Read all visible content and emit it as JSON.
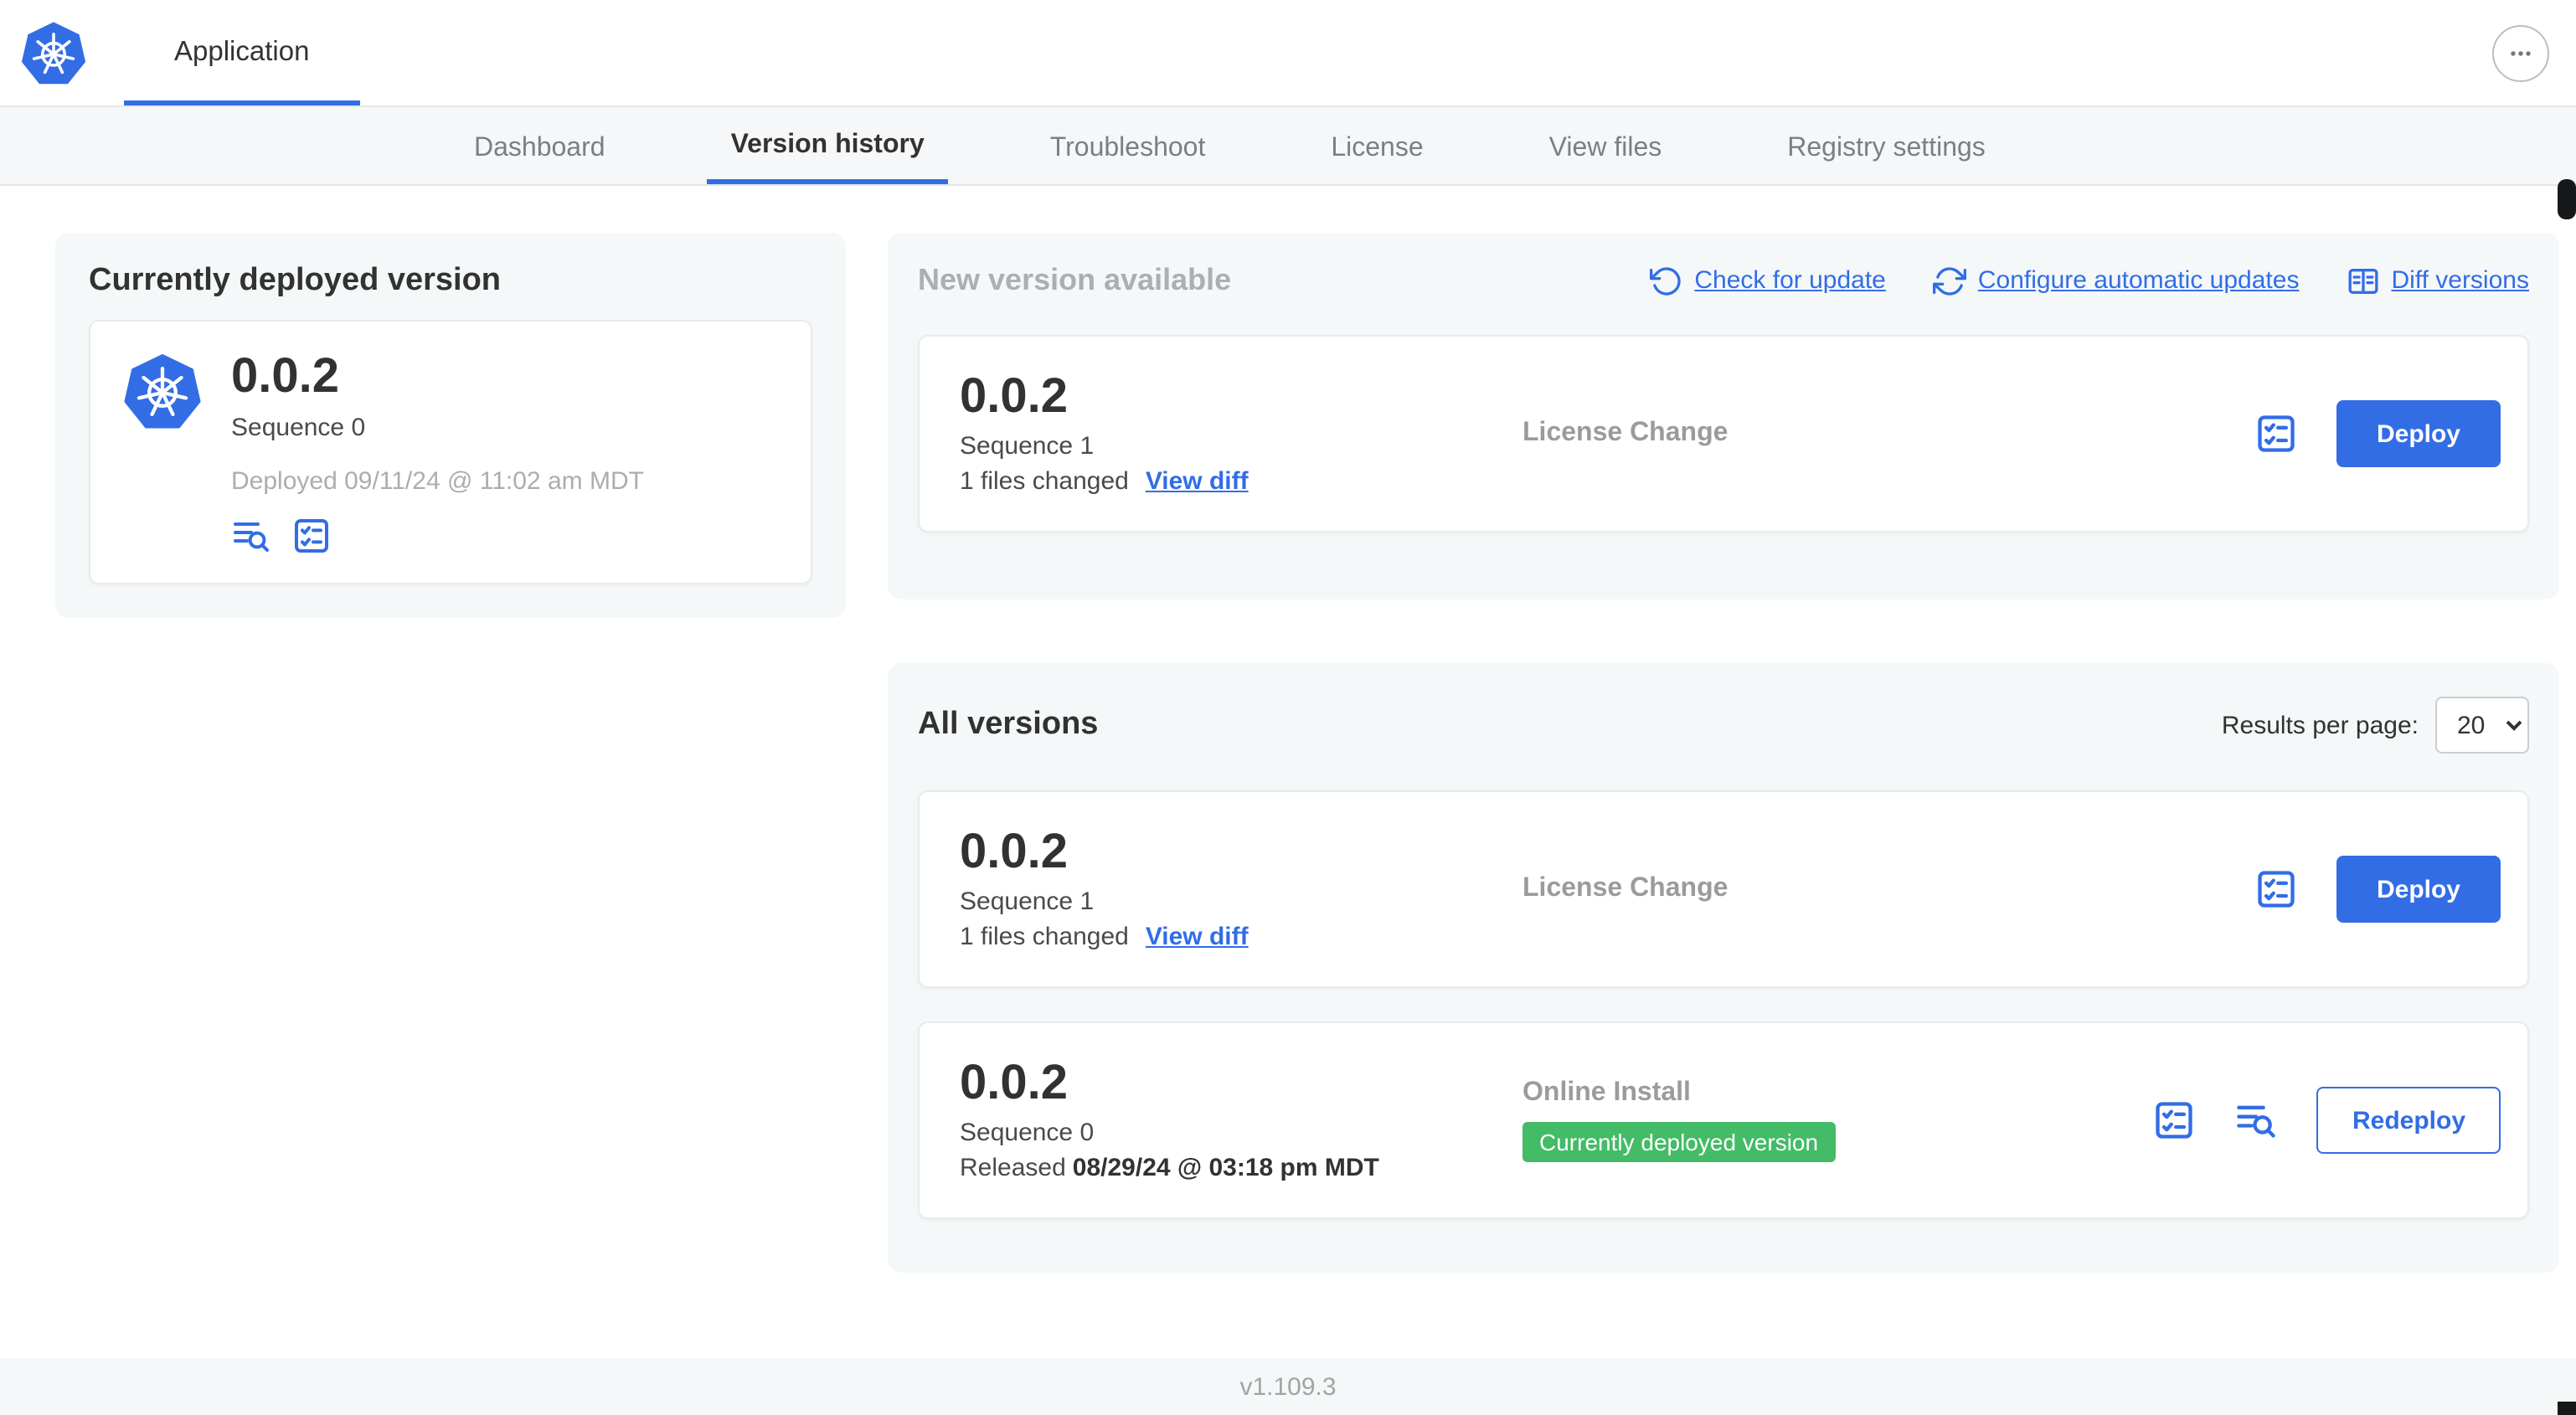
{
  "colors": {
    "accent": "#326de6",
    "badge_green": "#44bb66",
    "panel_bg": "#f5f8f9",
    "text_dark": "#323232",
    "text_gray": "#9b9b9b"
  },
  "icons": {
    "logo": "kubernetes-helm",
    "more": "ellipsis-horizontal",
    "check_for_update": "rotate-ccw-arrow",
    "configure_automatic_updates": "circular-sync-arrows",
    "diff_versions": "split-table-diff",
    "release_notes": "text-lines-magnifier",
    "view_config": "checklist-box"
  },
  "header": {
    "app_title": "Application"
  },
  "nav": {
    "tabs": [
      {
        "label": "Dashboard"
      },
      {
        "label": "Version history"
      },
      {
        "label": "Troubleshoot"
      },
      {
        "label": "License"
      },
      {
        "label": "View files"
      },
      {
        "label": "Registry settings"
      }
    ]
  },
  "current": {
    "title": "Currently deployed version",
    "version": "0.0.2",
    "sequence": "Sequence 0",
    "deployed": "Deployed 09/11/24 @ 11:02 am MDT"
  },
  "new_version": {
    "title": "New version available",
    "links": [
      {
        "label": "Check for update"
      },
      {
        "label": "Configure automatic updates"
      },
      {
        "label": "Diff versions"
      }
    ],
    "card": {
      "version": "0.0.2",
      "sequence": "Sequence 1",
      "files_changed": "1 files changed",
      "view_diff": "View diff",
      "source": "License Change",
      "deploy": "Deploy"
    }
  },
  "all_versions": {
    "title": "All versions",
    "per_page_label": "Results per page:",
    "per_page_value": "20",
    "rows": [
      {
        "version": "0.0.2",
        "sequence": "Sequence 1",
        "files_changed": "1 files changed",
        "view_diff": "View diff",
        "source": "License Change",
        "action": "Deploy"
      },
      {
        "version": "0.0.2",
        "sequence": "Sequence 0",
        "released_prefix": "Released",
        "released_date": "08/29/24 @ 03:18 pm MDT",
        "source": "Online Install",
        "badge": "Currently deployed version",
        "action": "Redeploy"
      }
    ]
  },
  "footer": {
    "app_version": "v1.109.3"
  }
}
